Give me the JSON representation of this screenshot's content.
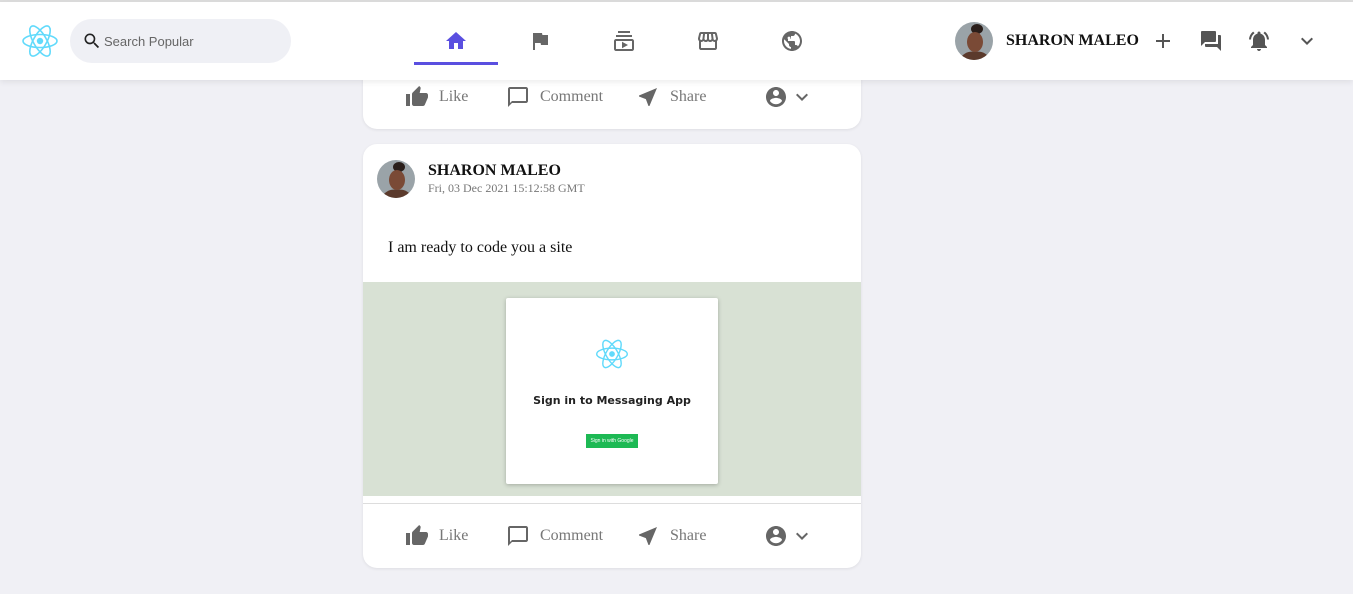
{
  "header": {
    "search_placeholder": "Search Popular",
    "user_name": "SHARON MALEO",
    "accent_color": "#5a4fe0",
    "logo_icon": "react-atom-icon",
    "nav_items": [
      {
        "icon": "home-icon",
        "active": true
      },
      {
        "icon": "flag-icon",
        "active": false
      },
      {
        "icon": "subscriptions-icon",
        "active": false
      },
      {
        "icon": "storefront-icon",
        "active": false
      },
      {
        "icon": "groups-icon",
        "active": false
      }
    ],
    "right_icons": [
      "add-icon",
      "forum-icon",
      "notifications-icon",
      "expand-more-icon"
    ]
  },
  "top_card": {
    "actions": {
      "like": "Like",
      "comment": "Comment",
      "share": "Share"
    }
  },
  "post": {
    "author": "SHARON MALEO",
    "timestamp": "Fri, 03 Dec 2021 15:12:58 GMT",
    "text": "I am ready to code you a site",
    "image": {
      "title": "Sign in to Messaging App",
      "button": "Sign in with Google"
    },
    "actions": {
      "like": "Like",
      "comment": "Comment",
      "share": "Share"
    }
  }
}
